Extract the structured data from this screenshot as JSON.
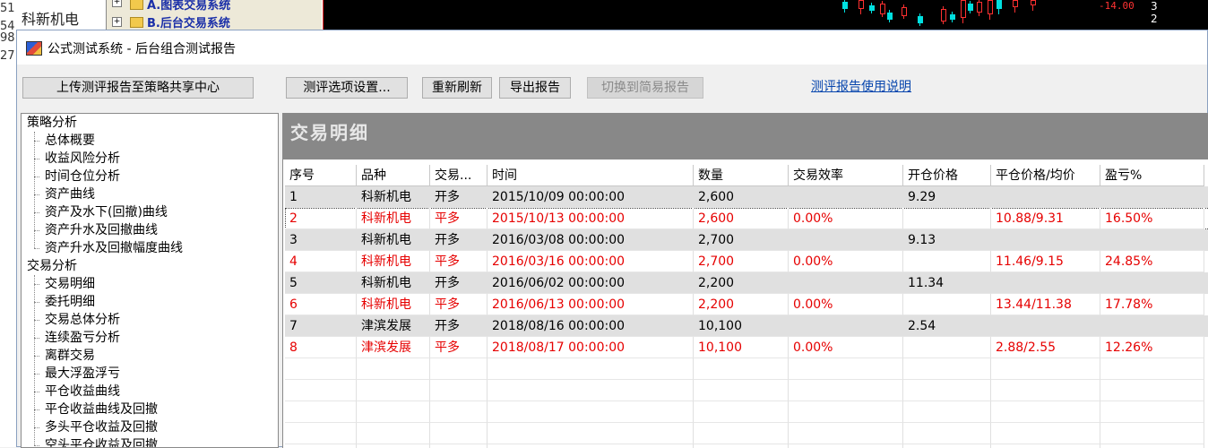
{
  "background": {
    "left_col": [
      "51",
      "54",
      "98",
      "27"
    ],
    "stock_name": "科新机电",
    "tree_items": [
      "A.图表交易系统",
      "B.后台交易系统"
    ],
    "price_label": "-14.00",
    "side_numbers": [
      "3",
      "2"
    ]
  },
  "window": {
    "title": "公式测试系统 - 后台组合测试报告"
  },
  "toolbar": {
    "upload": "上传测评报告至策略共享中心",
    "options": "测评选项设置...",
    "refresh": "重新刷新",
    "export": "导出报告",
    "switch": "切换到简易报告",
    "help_link": "测评报告使用说明"
  },
  "nav": {
    "sections": [
      {
        "label": "策略分析",
        "items": [
          "总体概要",
          "收益风险分析",
          "时间仓位分析",
          "资产曲线",
          "资产及水下(回撤)曲线",
          "资产升水及回撤曲线",
          "资产升水及回撤幅度曲线"
        ]
      },
      {
        "label": "交易分析",
        "items": [
          "交易明细",
          "委托明细",
          "交易总体分析",
          "连续盈亏分析",
          "离群交易",
          "最大浮盈浮亏",
          "平仓收益曲线",
          "平仓收益曲线及回撤",
          "多头平仓收益及回撤",
          "空头平仓收益及回撤"
        ]
      }
    ]
  },
  "panel": {
    "title": "交易明细"
  },
  "table": {
    "headers": [
      "序号",
      "品种",
      "交易...",
      "时间",
      "数量",
      "交易效率",
      "开仓价格",
      "平仓价格/均价",
      "盈亏%"
    ],
    "rows": [
      {
        "type": "open",
        "cells": [
          "1",
          "科新机电",
          "开多",
          "2015/10/09 00:00:00",
          "2,600",
          "",
          "9.29",
          "",
          ""
        ]
      },
      {
        "type": "close",
        "cells": [
          "2",
          "科新机电",
          "平多",
          "2015/10/13 00:00:00",
          "2,600",
          "0.00%",
          "",
          "10.88/9.31",
          "16.50%"
        ]
      },
      {
        "type": "open",
        "cells": [
          "3",
          "科新机电",
          "开多",
          "2016/03/08 00:00:00",
          "2,700",
          "",
          "9.13",
          "",
          ""
        ]
      },
      {
        "type": "close",
        "cells": [
          "4",
          "科新机电",
          "平多",
          "2016/03/16 00:00:00",
          "2,700",
          "0.00%",
          "",
          "11.46/9.15",
          "24.85%"
        ]
      },
      {
        "type": "open",
        "cells": [
          "5",
          "科新机电",
          "开多",
          "2016/06/02 00:00:00",
          "2,200",
          "",
          "11.34",
          "",
          ""
        ]
      },
      {
        "type": "close",
        "cells": [
          "6",
          "科新机电",
          "平多",
          "2016/06/13 00:00:00",
          "2,200",
          "0.00%",
          "",
          "13.44/11.38",
          "17.78%"
        ]
      },
      {
        "type": "open",
        "cells": [
          "7",
          "津滨发展",
          "开多",
          "2018/08/16 00:00:00",
          "10,100",
          "",
          "2.54",
          "",
          ""
        ]
      },
      {
        "type": "close",
        "cells": [
          "8",
          "津滨发展",
          "平多",
          "2018/08/17 00:00:00",
          "10,100",
          "0.00%",
          "",
          "2.88/2.55",
          "12.26%"
        ]
      }
    ]
  },
  "colors": {
    "close_row_text": "#e60000",
    "open_row_bg": "#e0e0e0",
    "panel_header_bg": "#888888",
    "link": "#0645ad"
  }
}
